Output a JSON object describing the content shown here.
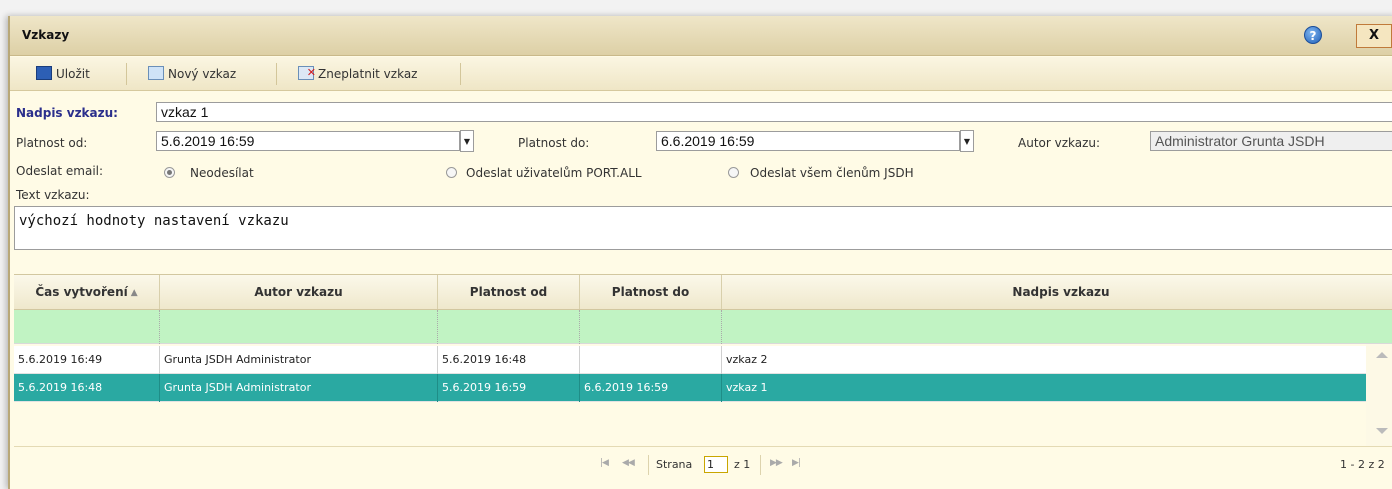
{
  "window": {
    "title": "Vzkazy",
    "help_icon": "question-circle-icon",
    "close_label": "X"
  },
  "toolbar": {
    "save_label": "Uložit",
    "new_label": "Nový vzkaz",
    "invalidate_label": "Zneplatnit vzkaz"
  },
  "form": {
    "title_label": "Nadpis vzkazu:",
    "title_value": "vzkaz 1",
    "valid_from_label": "Platnost od:",
    "valid_from_value": "5.6.2019 16:59",
    "valid_to_label": "Platnost do:",
    "valid_to_value": "6.6.2019 16:59",
    "author_label": "Autor vzkazu:",
    "author_value": "Administrator Grunta JSDH",
    "email_label": "Odeslat email:",
    "email_options": [
      "Neodesílat",
      "Odeslat uživatelům PORT.ALL",
      "Odeslat všem členům JSDH"
    ],
    "email_selected": "Neodesílat",
    "text_label": "Text vzkazu:",
    "text_value": "výchozí hodnoty nastavení vzkazu"
  },
  "grid": {
    "columns": [
      "Čas vytvoření",
      "Autor vzkazu",
      "Platnost od",
      "Platnost do",
      "Nadpis vzkazu"
    ],
    "sort_column": "Čas vytvoření",
    "rows": [
      {
        "created": "5.6.2019 16:49",
        "author": "Grunta JSDH Administrator",
        "from": "5.6.2019 16:48",
        "to": "",
        "title": "vzkaz 2"
      },
      {
        "created": "5.6.2019 16:48",
        "author": "Grunta JSDH Administrator",
        "from": "5.6.2019 16:59",
        "to": "6.6.2019 16:59",
        "title": "vzkaz 1"
      }
    ],
    "selected_row": 1
  },
  "pager": {
    "page_label": "Strana",
    "page_value": "1",
    "of_label": "z 1",
    "summary": "1 - 2 z 2"
  },
  "colors": {
    "selected_row": "#2aa9a2",
    "filter_row": "#c1f3c3",
    "label_accent": "#2b2f8c"
  }
}
